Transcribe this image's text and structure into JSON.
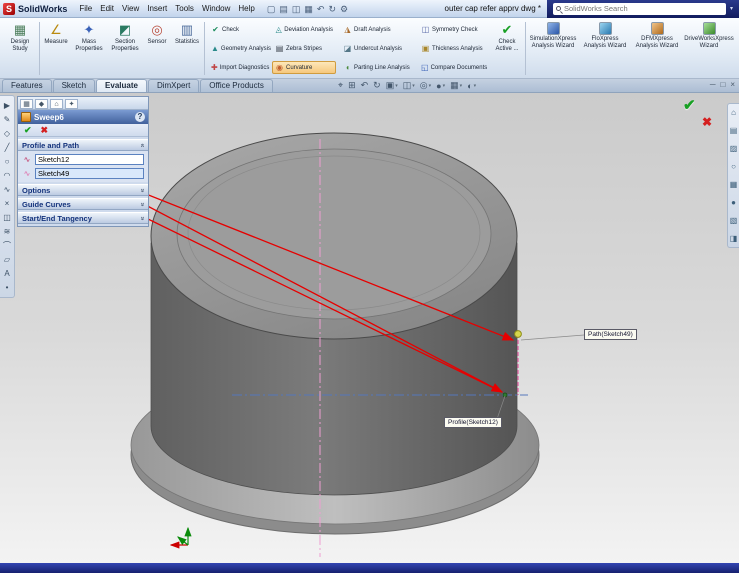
{
  "titlebar": {
    "app": "SolidWorks",
    "menus": [
      "File",
      "Edit",
      "View",
      "Insert",
      "Tools",
      "Window",
      "Help"
    ],
    "doc_name": "outer cap refer apprv dwg *",
    "search_placeholder": "SolidWorks Search"
  },
  "ribbon": {
    "large_buttons": [
      {
        "label": "Design Study"
      },
      {
        "label": "Measure"
      },
      {
        "label": "Mass Properties"
      },
      {
        "label": "Section Properties"
      },
      {
        "label": "Sensor"
      },
      {
        "label": "Statistics"
      }
    ],
    "small_columns": [
      [
        "Check",
        "Geometry Analysis",
        "Import Diagnostics"
      ],
      [
        "Deviation Analysis",
        "Zebra Stripes",
        "Curvature"
      ],
      [
        "Draft Analysis",
        "Undercut Analysis",
        "Parting Line Analysis"
      ],
      [
        "Symmetry Check",
        "Thickness Analysis",
        "Compare Documents"
      ]
    ],
    "selected_item": "Curvature",
    "check_active_label": "Check Active ...",
    "wizards": [
      "SimulationXpress Analysis Wizard",
      "FloXpress Analysis Wizard",
      "DFMXpress Analysis Wizard",
      "DriveWorksXpress Wizard"
    ]
  },
  "tabs": {
    "items": [
      "Features",
      "Sketch",
      "Evaluate",
      "DimXpert",
      "Office Products"
    ],
    "active": "Evaluate"
  },
  "property_manager": {
    "title": "Sweep6",
    "help": "?",
    "ok": "✔",
    "cancel": "✖",
    "sections": {
      "profile_and_path": "Profile and Path",
      "options": "Options",
      "guide_curves": "Guide Curves",
      "start_end_tangency": "Start/End Tangency"
    },
    "profile_value": "Sketch12",
    "path_value": "Sketch49",
    "chevron_expanded": "«",
    "chevron_collapsed": "»"
  },
  "viewport": {
    "callouts": {
      "path": "Path(Sketch49)",
      "profile": "Profile(Sketch12)"
    }
  },
  "icons": {
    "logo_letter": "S",
    "new": "▢",
    "open": "▤",
    "save": "◫",
    "print": "▦",
    "undo": "↶",
    "rebuild": "↻",
    "options": "⚙",
    "design_study": "▦",
    "measure": "∠",
    "mass_properties": "✦",
    "section_properties": "◩",
    "sensor": "◎",
    "statistics": "▥",
    "check": "✔",
    "geometry_analysis": "▲",
    "import_diagnostics": "✚",
    "deviation_analysis": "◬",
    "zebra_stripes": "▤",
    "curvature": "◉",
    "draft_analysis": "◮",
    "undercut_analysis": "◪",
    "parting_line_analysis": "◖",
    "symmetry_check": "◫",
    "thickness_analysis": "▣",
    "compare_documents": "◱",
    "check_active": "✔",
    "pm_tabs": [
      {
        "glyph": "▦"
      },
      {
        "glyph": "◆"
      },
      {
        "glyph": "⌂"
      },
      {
        "glyph": "✦"
      }
    ],
    "profile_field": "∿",
    "path_field": "∿",
    "viewport_toolbar": [
      {
        "glyph": "⌖"
      },
      {
        "glyph": "⊞"
      },
      {
        "glyph": "↶"
      },
      {
        "glyph": "↻"
      },
      {
        "glyph": "▣",
        "caret": "▾"
      },
      {
        "glyph": "◫",
        "caret": "▾"
      },
      {
        "glyph": "◎",
        "caret": "▾"
      },
      {
        "glyph": "●",
        "caret": "▾"
      },
      {
        "glyph": "▦",
        "caret": "▾"
      },
      {
        "glyph": "◐",
        "caret": "▾"
      }
    ],
    "doc_buttons": [
      {
        "glyph": "─"
      },
      {
        "glyph": "□"
      },
      {
        "glyph": "×"
      }
    ],
    "left_toolbar": [
      {
        "glyph": "▶"
      },
      {
        "glyph": "✎"
      },
      {
        "glyph": "◇"
      },
      {
        "glyph": "╱"
      },
      {
        "glyph": "○"
      },
      {
        "glyph": "◠"
      },
      {
        "glyph": "∿"
      },
      {
        "glyph": "×"
      },
      {
        "glyph": "◫"
      },
      {
        "glyph": "≋"
      },
      {
        "glyph": "⌒"
      },
      {
        "glyph": "▱"
      },
      {
        "glyph": "A"
      },
      {
        "glyph": "•"
      }
    ],
    "task_pane": [
      {
        "glyph": "⌂"
      },
      {
        "glyph": "▤"
      },
      {
        "glyph": "▨"
      },
      {
        "glyph": "○"
      },
      {
        "glyph": "▦"
      },
      {
        "glyph": "●"
      },
      {
        "glyph": "▧"
      },
      {
        "glyph": "◨"
      }
    ]
  },
  "colors": {
    "accent_red": "#e60000",
    "status_bar": "#1e2c96",
    "search_bg": "#121c5e",
    "pm_header": "#5578b4",
    "selected_command_bg": "#f6c87d"
  }
}
